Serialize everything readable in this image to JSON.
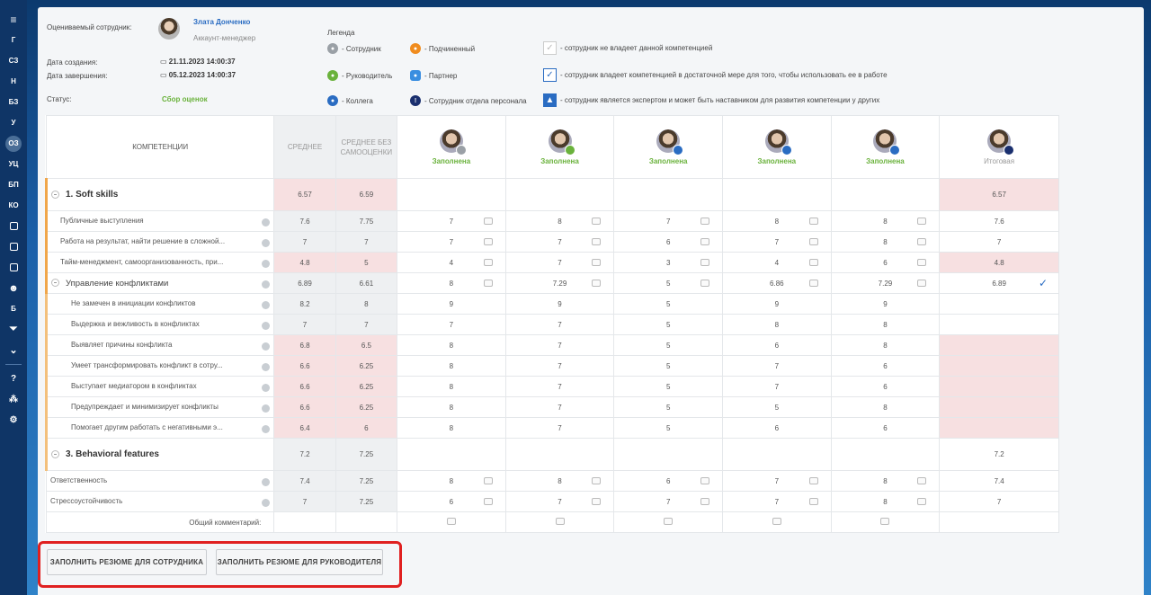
{
  "sidebar": {
    "items": [
      "Г",
      "СЗ",
      "Н",
      "БЗ",
      "У",
      "ОЗ",
      "УЦ",
      "БП",
      "КО"
    ],
    "lower_items": [
      "Б"
    ],
    "active": "ОЗ"
  },
  "info": {
    "employee_label": "Оцениваемый сотрудник:",
    "employee_name": "Злата Донченко",
    "employee_role": "Аккаунт-менеджер",
    "created_label": "Дата создания:",
    "created_value": "21.11.2023 14:00:37",
    "finished_label": "Дата завершения:",
    "finished_value": "05.12.2023 14:00:37",
    "status_label": "Статус:",
    "status_value": "Сбор оценок"
  },
  "legend": {
    "title": "Легенда",
    "employee": "- Сотрудник",
    "subordinate": "- Подчиненный",
    "manager": "- Руководитель",
    "partner": "- Партнер",
    "colleague": "- Коллега",
    "hr": "- Сотрудник отдела персонала",
    "no_comp": "- сотрудник не владеет данной компетенцией",
    "has_comp": "- сотрудник владеет компетенцией в достаточной мере для того, чтобы использовать ее в работе",
    "expert": "- сотрудник является экспертом и может быть наставником для развития компетенции у других"
  },
  "colors": {
    "employee": "#9aa0a6",
    "subordinate": "#f08c1e",
    "manager": "#6ab23c",
    "partner": "#3a8ee0",
    "colleague": "#2a6cc2",
    "hr": "#1a2f6e"
  },
  "table": {
    "h_comp": "КОМПЕТЕНЦИИ",
    "h_avg": "СРЕДНЕЕ",
    "h_avg_self": "СРЕДНЕЕ БЕЗ САМООЦЕНКИ",
    "raters": [
      {
        "status": "Заполнена",
        "badge": "employee"
      },
      {
        "status": "Заполнена",
        "badge": "manager"
      },
      {
        "status": "Заполнена",
        "badge": "colleague"
      },
      {
        "status": "Заполнена",
        "badge": "colleague"
      },
      {
        "status": "Заполнена",
        "badge": "colleague"
      }
    ],
    "final_label": "Итоговая",
    "rows": [
      {
        "name": "1. Soft skills",
        "avg": "6.57",
        "avg_self": "6.59",
        "scores": [
          "",
          "",
          "",
          "",
          ""
        ],
        "final": "6.57"
      },
      {
        "name": "Публичные выступления",
        "avg": "7.6",
        "avg_self": "7.75",
        "scores": [
          "7",
          "8",
          "7",
          "8",
          "8"
        ],
        "final": "7.6"
      },
      {
        "name": "Работа на результат, найти решение в сложной...",
        "avg": "7",
        "avg_self": "7",
        "scores": [
          "7",
          "7",
          "6",
          "7",
          "8"
        ],
        "final": "7"
      },
      {
        "name": "Тайм-менеджмент, самоорганизованность, при...",
        "avg": "4.8",
        "avg_self": "5",
        "scores": [
          "4",
          "7",
          "3",
          "4",
          "6"
        ],
        "final": "4.8"
      },
      {
        "name": "Управление конфликтами",
        "avg": "6.89",
        "avg_self": "6.61",
        "scores": [
          "8",
          "7.29",
          "5",
          "6.86",
          "7.29"
        ],
        "final": "6.89"
      },
      {
        "name": "Не замечен в инициации конфликтов",
        "avg": "8.2",
        "avg_self": "8",
        "scores": [
          "9",
          "9",
          "5",
          "9",
          "9"
        ],
        "final": ""
      },
      {
        "name": "Выдержка и вежливость в конфликтах",
        "avg": "7",
        "avg_self": "7",
        "scores": [
          "7",
          "7",
          "5",
          "8",
          "8"
        ],
        "final": ""
      },
      {
        "name": "Выявляет причины конфликта",
        "avg": "6.8",
        "avg_self": "6.5",
        "scores": [
          "8",
          "7",
          "5",
          "6",
          "8"
        ],
        "final": ""
      },
      {
        "name": "Умеет трансформировать конфликт в сотру...",
        "avg": "6.6",
        "avg_self": "6.25",
        "scores": [
          "8",
          "7",
          "5",
          "7",
          "6"
        ],
        "final": ""
      },
      {
        "name": "Выступает медиатором в конфликтах",
        "avg": "6.6",
        "avg_self": "6.25",
        "scores": [
          "8",
          "7",
          "5",
          "7",
          "6"
        ],
        "final": ""
      },
      {
        "name": "Предупреждает и минимизирует конфликты",
        "avg": "6.6",
        "avg_self": "6.25",
        "scores": [
          "8",
          "7",
          "5",
          "5",
          "8"
        ],
        "final": ""
      },
      {
        "name": "Помогает другим работать с негативными э...",
        "avg": "6.4",
        "avg_self": "6",
        "scores": [
          "8",
          "7",
          "5",
          "6",
          "6"
        ],
        "final": ""
      },
      {
        "name": "3. Behavioral features",
        "avg": "7.2",
        "avg_self": "7.25",
        "scores": [
          "",
          "",
          "",
          "",
          ""
        ],
        "final": "7.2"
      },
      {
        "name": "Ответственность",
        "avg": "7.4",
        "avg_self": "7.25",
        "scores": [
          "8",
          "8",
          "6",
          "7",
          "8"
        ],
        "final": "7.4"
      },
      {
        "name": "Стрессоустойчивость",
        "avg": "7",
        "avg_self": "7.25",
        "scores": [
          "6",
          "7",
          "7",
          "7",
          "8"
        ],
        "final": "7"
      }
    ],
    "comment_label": "Общий комментарий:"
  },
  "buttons": {
    "fill_employee": "ЗАПОЛНИТЬ РЕЗЮМЕ ДЛЯ СОТРУДНИКА",
    "fill_manager": "ЗАПОЛНИТЬ РЕЗЮМЕ ДЛЯ РУКОВОДИТЕЛЯ"
  }
}
